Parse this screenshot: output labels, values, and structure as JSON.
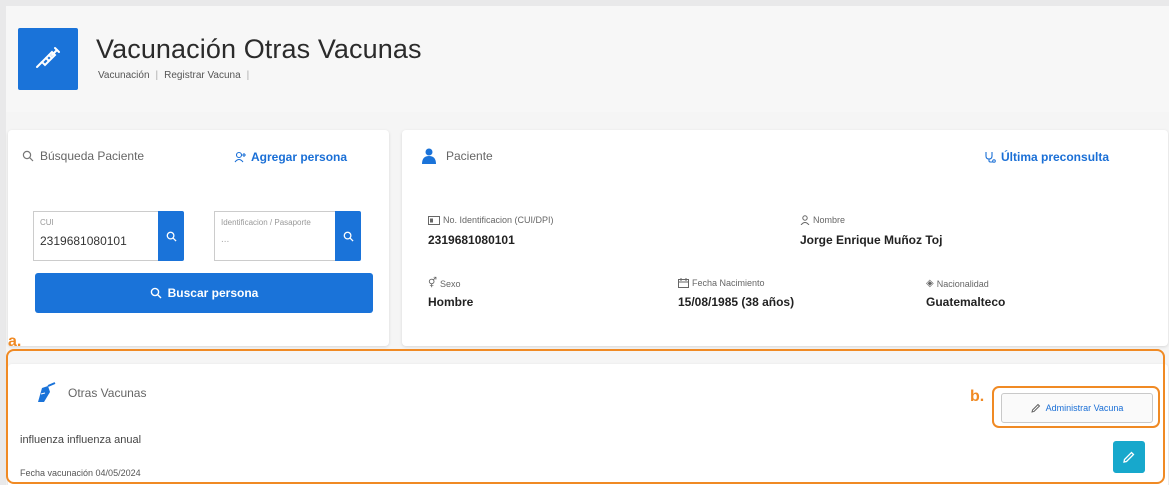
{
  "header": {
    "title": "Vacunación Otras Vacunas",
    "breadcrumb": [
      "Vacunación",
      "Registrar Vacuna"
    ],
    "icon": "syringe-icon"
  },
  "search": {
    "title": "Búsqueda Paciente",
    "add_person": "Agregar persona",
    "cui_label": "CUI",
    "cui_value": "2319681080101",
    "id_label": "Identificacion / Pasaporte",
    "id_value": "...",
    "search_button": "Buscar persona"
  },
  "patient": {
    "title": "Paciente",
    "last_preconsult": "Última preconsulta",
    "id_label": "No. Identificacion (CUI/DPI)",
    "id_value": "2319681080101",
    "name_label": "Nombre",
    "name_value": "Jorge Enrique Muñoz Toj",
    "sex_label": "Sexo",
    "sex_value": "Hombre",
    "birth_label": "Fecha Nacimiento",
    "birth_value": "15/08/1985 (38 años)",
    "nationality_label": "Nacionalidad",
    "nationality_value": "Guatemalteco"
  },
  "vaccines": {
    "title": "Otras Vacunas",
    "admin_button": "Administrar Vacuna",
    "item_name": "influenza influenza anual",
    "item_date": "Fecha vacunación 04/05/2024"
  },
  "annotations": {
    "a": "a.",
    "b": "b."
  },
  "colors": {
    "primary": "#1a73d9",
    "accent": "#f08a24",
    "teal": "#17a8cc"
  }
}
